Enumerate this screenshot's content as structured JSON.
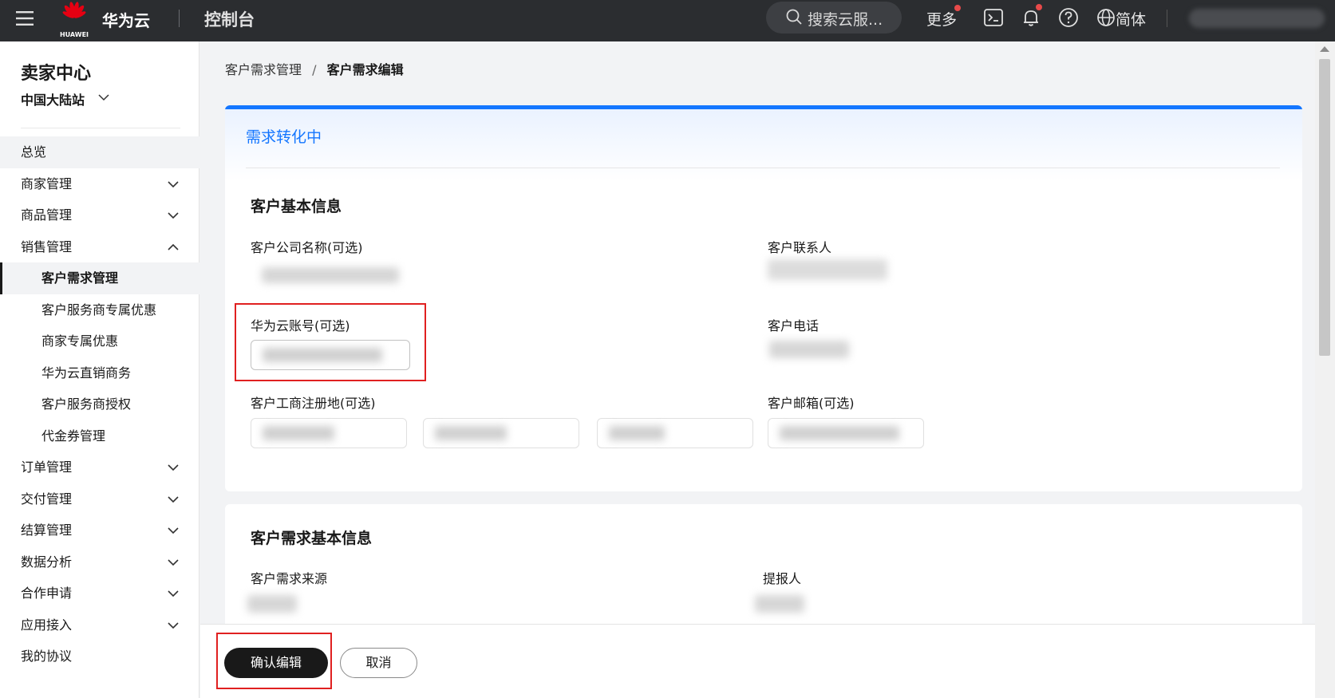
{
  "topbar": {
    "logo_text": "HUAWEI",
    "brand": "华为云",
    "console": "控制台",
    "search_placeholder": "搜索云服...",
    "more": "更多",
    "language": "简体"
  },
  "sidebar": {
    "title": "卖家中心",
    "site": "中国大陆站",
    "items": [
      {
        "label": "总览"
      },
      {
        "label": "商家管理"
      },
      {
        "label": "商品管理"
      },
      {
        "label": "销售管理"
      },
      {
        "label": "客户需求管理"
      },
      {
        "label": "客户服务商专属优惠"
      },
      {
        "label": "商家专属优惠"
      },
      {
        "label": "华为云直销商务"
      },
      {
        "label": "客户服务商授权"
      },
      {
        "label": "代金券管理"
      },
      {
        "label": "订单管理"
      },
      {
        "label": "交付管理"
      },
      {
        "label": "结算管理"
      },
      {
        "label": "数据分析"
      },
      {
        "label": "合作申请"
      },
      {
        "label": "应用接入"
      },
      {
        "label": "我的协议"
      }
    ]
  },
  "breadcrumb": {
    "parent": "客户需求管理",
    "separator": "/",
    "current": "客户需求编辑"
  },
  "status": "需求转化中",
  "basic_info": {
    "title": "客户基本信息",
    "company_label": "客户公司名称(可选)",
    "contact_label": "客户联系人",
    "account_label": "华为云账号(可选)",
    "phone_label": "客户电话",
    "address_label": "客户工商注册地(可选)",
    "email_label": "客户邮箱(可选)"
  },
  "demand_info": {
    "title": "客户需求基本信息",
    "source_label": "客户需求来源",
    "reporter_label": "提报人"
  },
  "footer": {
    "confirm": "确认编辑",
    "cancel": "取消"
  },
  "colors": {
    "topbar": "#2b2d30",
    "accent": "#1476ff",
    "highlight": "#e02020",
    "primary_button": "#191919"
  }
}
